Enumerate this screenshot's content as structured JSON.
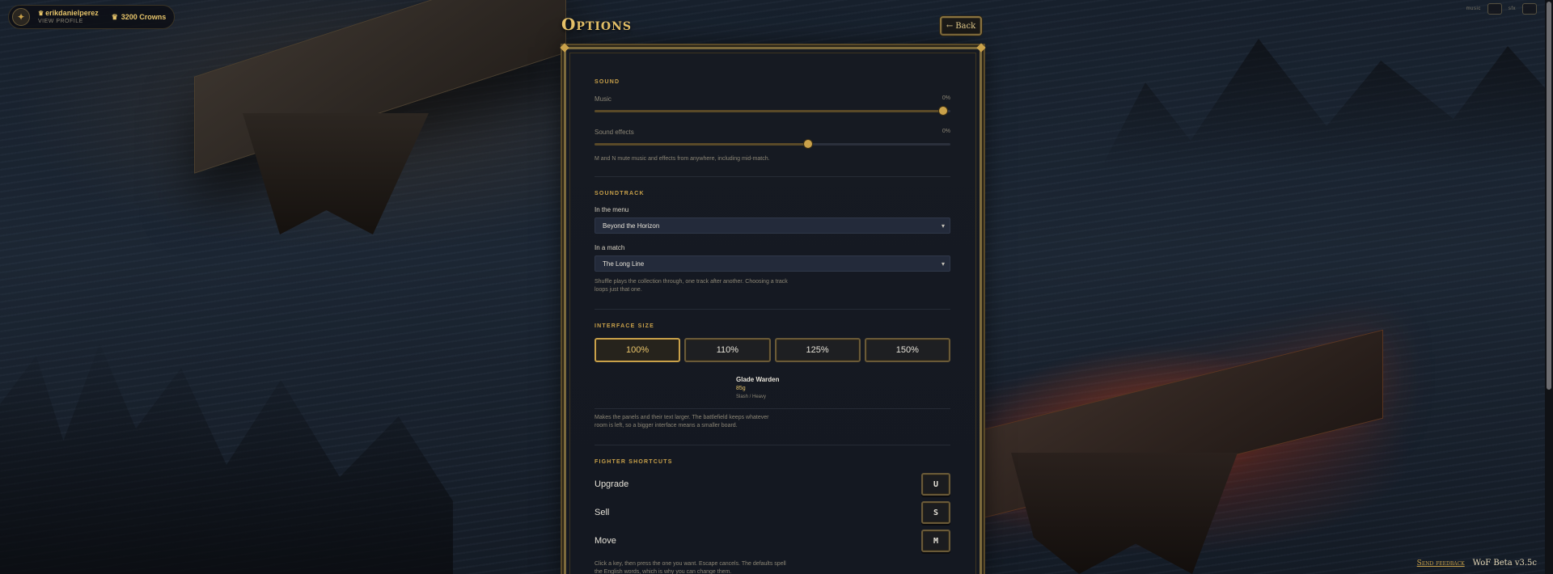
{
  "header": {
    "username": "erikdanielperez",
    "view_profile": "VIEW PROFILE",
    "currency": "3200 Crowns",
    "title": "Options",
    "back_label": "Back",
    "back_arrow": "←",
    "topright_music": "music",
    "topright_sfx": "sfx"
  },
  "sound": {
    "section": "SOUND",
    "music_label": "Music",
    "music_value": "0%",
    "music_level": 0.98,
    "sfx_label": "Sound effects",
    "sfx_value": "0%",
    "sfx_level": 0.6,
    "hint": "M and N mute music and effects from anywhere, including mid-match."
  },
  "soundtrack": {
    "section": "SOUNDTRACK",
    "menu_label": "In the menu",
    "menu_value": "Beyond the Horizon",
    "match_label": "In a match",
    "match_value": "The Long Line",
    "hint": "Shuffle plays the collection through, one track after another. Choosing a track loops just that one."
  },
  "interface": {
    "section": "INTERFACE SIZE",
    "options": [
      "100%",
      "110%",
      "125%",
      "150%"
    ],
    "selected": "100%",
    "preview_name": "Glade Warden",
    "preview_price": "85g",
    "preview_type": "Slash / Heavy",
    "hint": "Makes the panels and their text larger. The battlefield keeps whatever room is left, so a bigger interface means a smaller board."
  },
  "shortcuts": {
    "section": "FIGHTER SHORTCUTS",
    "items": [
      {
        "label": "Upgrade",
        "key": "U"
      },
      {
        "label": "Sell",
        "key": "S"
      },
      {
        "label": "Move",
        "key": "M"
      }
    ],
    "hint": "Click a key, then press the one you want. Escape cancels. The defaults spell the English words, which is why you can change them."
  },
  "footer": {
    "feedback": "Send feedback",
    "version": "WoF Beta v3.5c"
  },
  "colors": {
    "accent_gold": "#c9a14a",
    "panel_bg": "#161a22",
    "border_gold": "#7c6a3c"
  }
}
